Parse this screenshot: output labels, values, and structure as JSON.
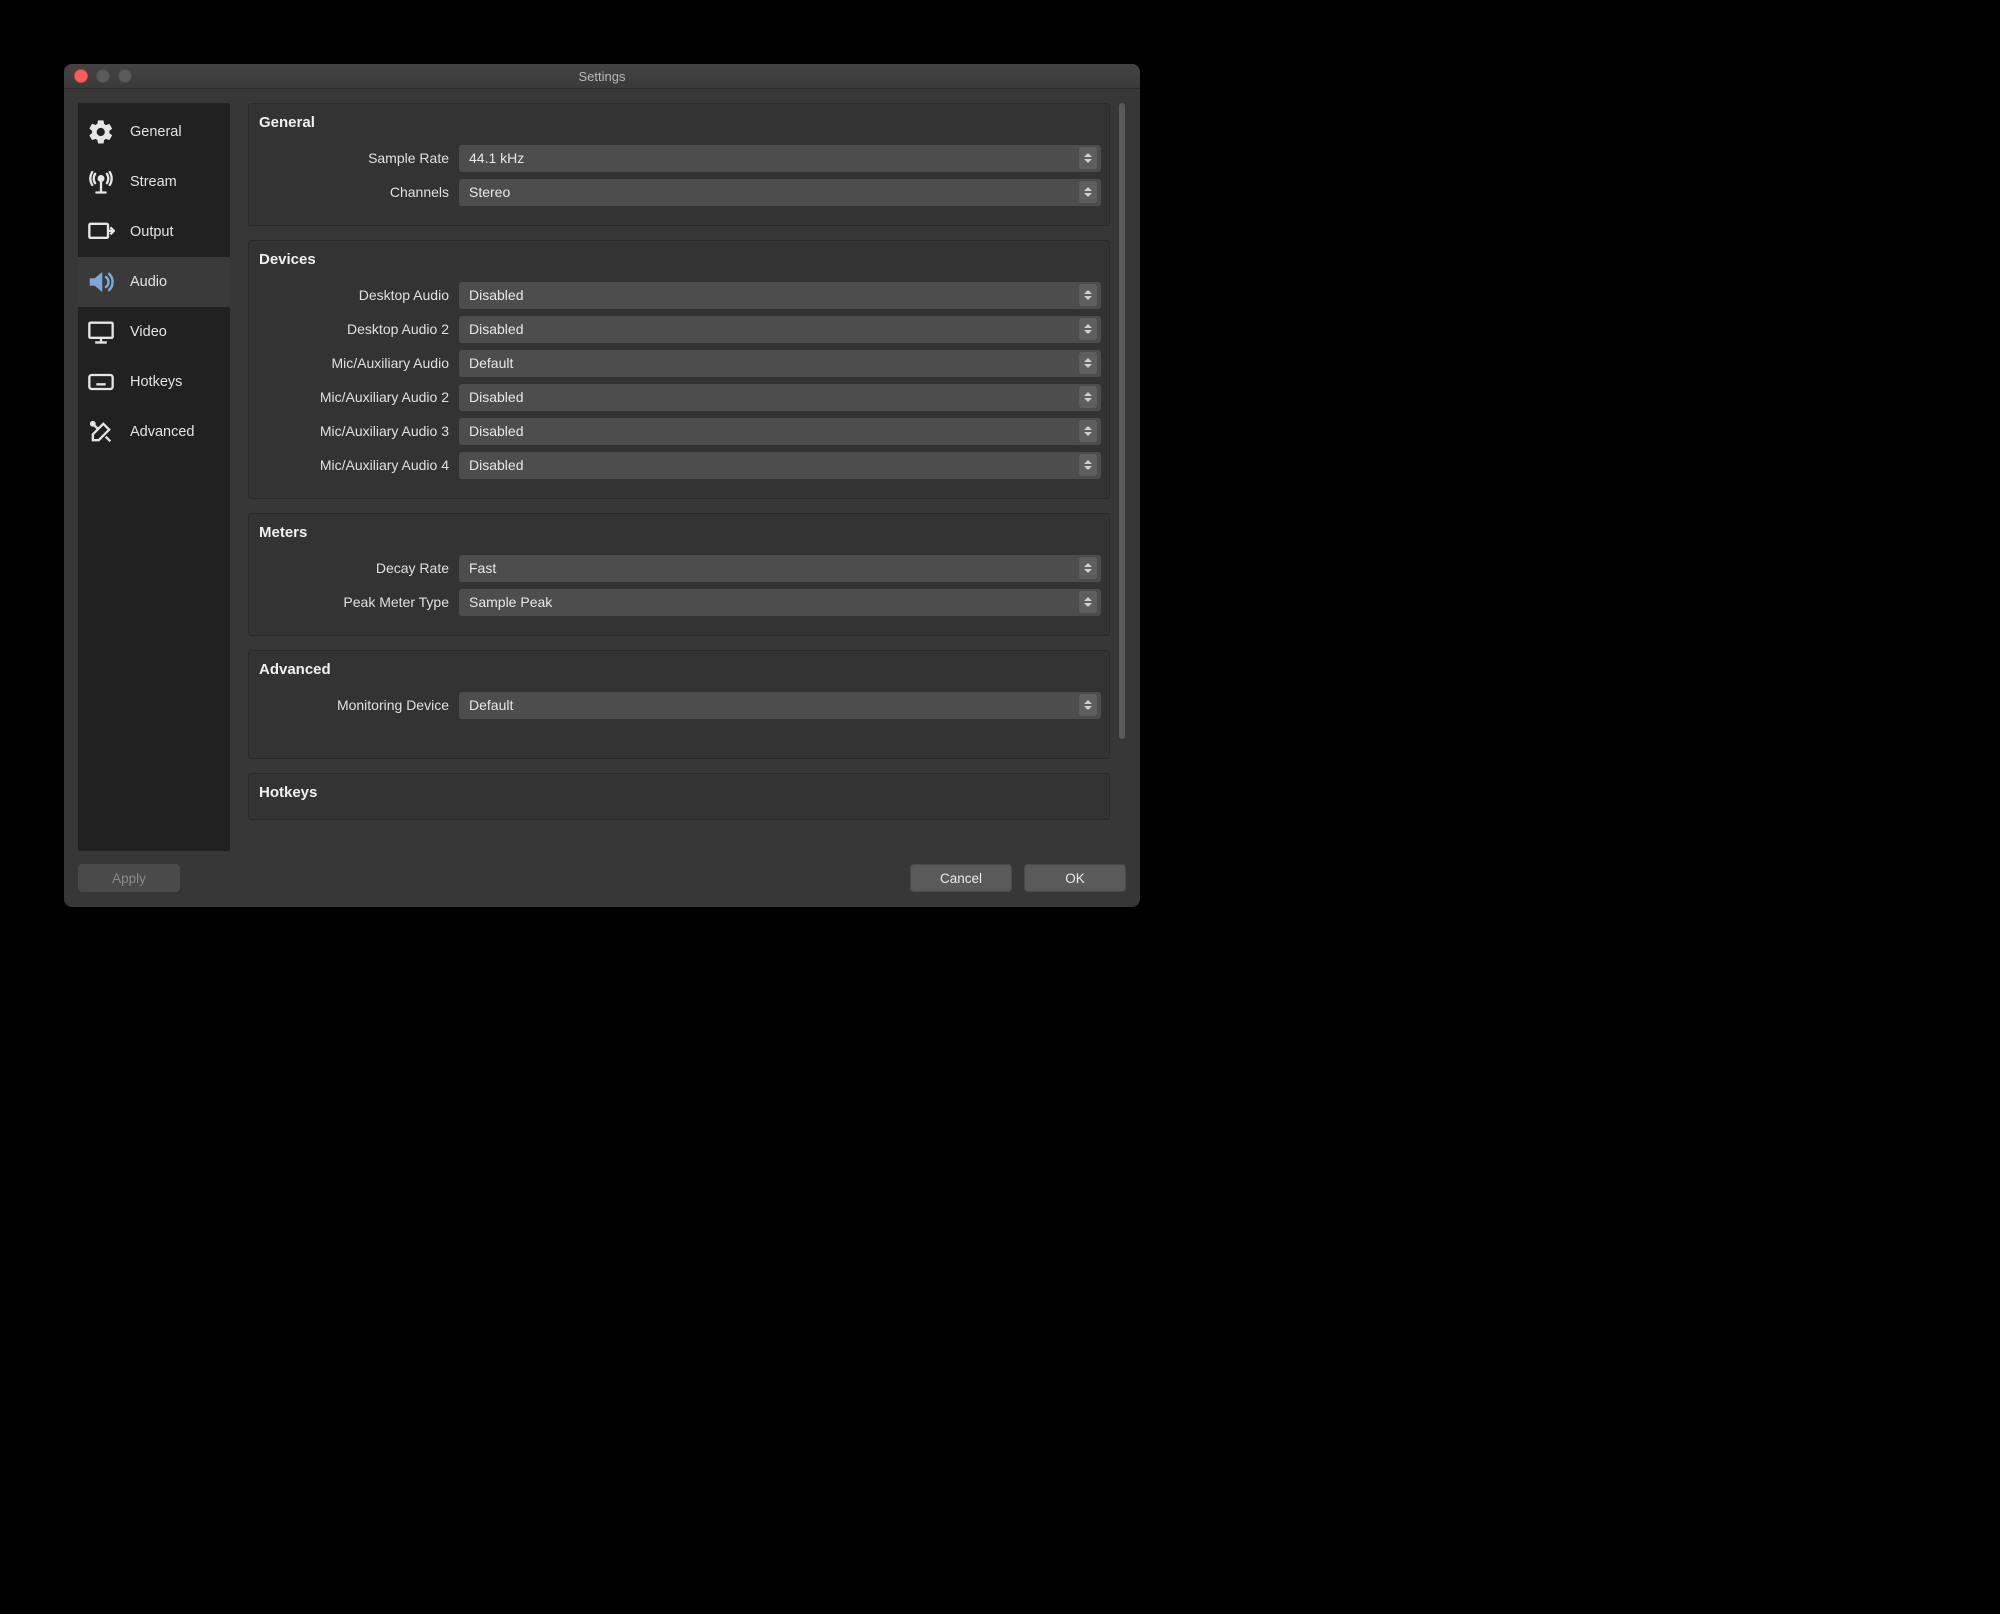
{
  "window": {
    "title": "Settings"
  },
  "sidebar": {
    "items": [
      {
        "label": "General"
      },
      {
        "label": "Stream"
      },
      {
        "label": "Output"
      },
      {
        "label": "Audio"
      },
      {
        "label": "Video"
      },
      {
        "label": "Hotkeys"
      },
      {
        "label": "Advanced"
      }
    ],
    "active_index": 3
  },
  "sections": {
    "general": {
      "title": "General",
      "sample_rate": {
        "label": "Sample Rate",
        "value": "44.1 kHz"
      },
      "channels": {
        "label": "Channels",
        "value": "Stereo"
      }
    },
    "devices": {
      "title": "Devices",
      "desktop_audio": {
        "label": "Desktop Audio",
        "value": "Disabled"
      },
      "desktop_audio_2": {
        "label": "Desktop Audio 2",
        "value": "Disabled"
      },
      "mic_aux": {
        "label": "Mic/Auxiliary Audio",
        "value": "Default"
      },
      "mic_aux_2": {
        "label": "Mic/Auxiliary Audio 2",
        "value": "Disabled"
      },
      "mic_aux_3": {
        "label": "Mic/Auxiliary Audio 3",
        "value": "Disabled"
      },
      "mic_aux_4": {
        "label": "Mic/Auxiliary Audio 4",
        "value": "Disabled"
      }
    },
    "meters": {
      "title": "Meters",
      "decay_rate": {
        "label": "Decay Rate",
        "value": "Fast"
      },
      "peak_meter_type": {
        "label": "Peak Meter Type",
        "value": "Sample Peak"
      }
    },
    "advanced": {
      "title": "Advanced",
      "monitoring_device": {
        "label": "Monitoring Device",
        "value": "Default"
      }
    },
    "hotkeys": {
      "title": "Hotkeys"
    }
  },
  "footer": {
    "apply": "Apply",
    "cancel": "Cancel",
    "ok": "OK"
  }
}
